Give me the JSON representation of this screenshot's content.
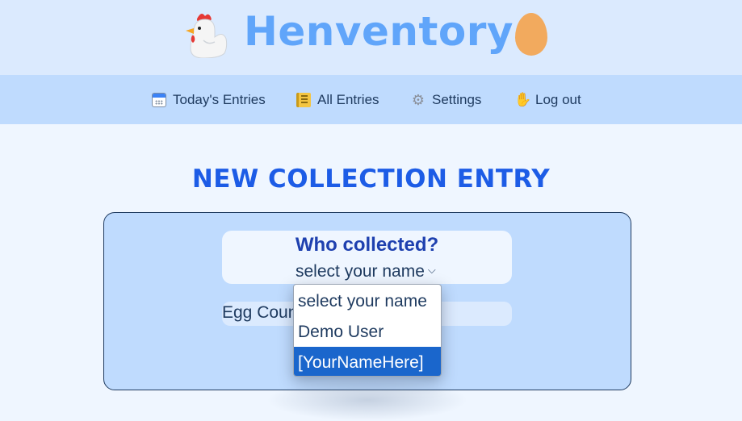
{
  "header": {
    "brand_title": "Henventory",
    "logo_left_icon": "chicken-icon",
    "logo_right_icon": "egg-icon"
  },
  "nav": {
    "items": [
      {
        "label": "Today's Entries",
        "icon": "calendar-icon"
      },
      {
        "label": "All Entries",
        "icon": "notebook-icon"
      },
      {
        "label": "Settings",
        "icon": "gear-icon"
      },
      {
        "label": "Log out",
        "icon": "waving-hand-icon"
      }
    ]
  },
  "main": {
    "title": "NEW COLLECTION ENTRY",
    "who_label": "Who collected?",
    "name_select_value": "select your name",
    "egg_count_label": "Egg Coun",
    "dropdown_options": [
      "select your name",
      "Demo User",
      "[YourNameHere]"
    ],
    "dropdown_highlighted": "[YourNameHere]"
  },
  "colors": {
    "header_bg": "#dbeafe",
    "nav_bg": "#bfdbfe",
    "brand": "#60a5fa",
    "title": "#1d5ce6",
    "highlight": "#1a66cc",
    "egg": "#f2aa5e"
  }
}
